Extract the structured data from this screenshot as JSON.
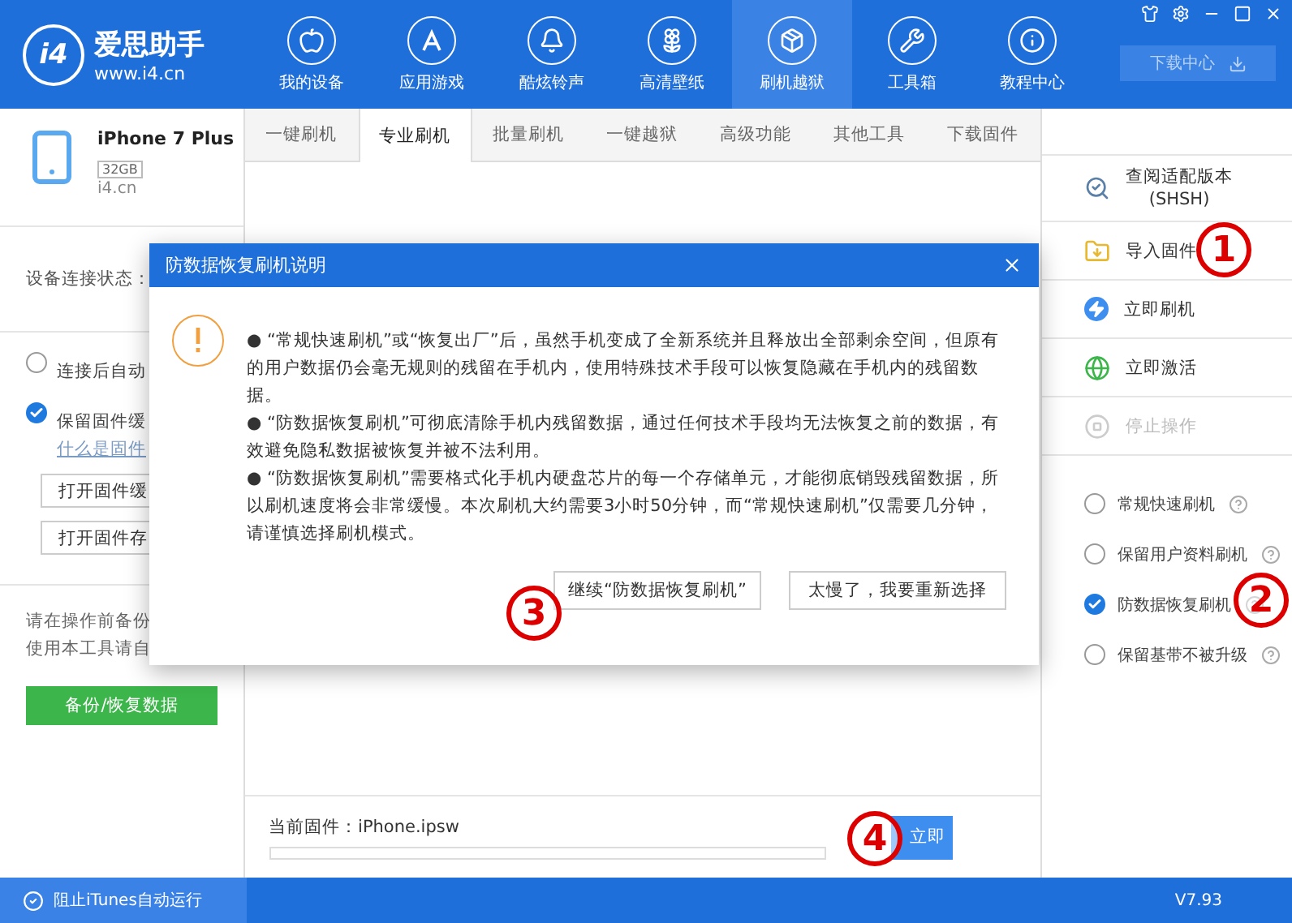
{
  "app": {
    "logo_mark": "i4",
    "name": "爱思助手",
    "url": "www.i4.cn"
  },
  "nav": [
    {
      "label": "我的设备",
      "selected": false
    },
    {
      "label": "应用游戏",
      "selected": false
    },
    {
      "label": "酷炫铃声",
      "selected": false
    },
    {
      "label": "高清壁纸",
      "selected": false
    },
    {
      "label": "刷机越狱",
      "selected": true
    },
    {
      "label": "工具箱",
      "selected": false
    },
    {
      "label": "教程中心",
      "selected": false
    }
  ],
  "download_center": "下载中心",
  "device": {
    "name": "iPhone 7 Plus",
    "capacity": "32GB",
    "source": "i4.cn"
  },
  "sidebar": {
    "status_label": "设备连接状态：",
    "options": [
      {
        "label": "连接后自动",
        "checked": false
      },
      {
        "label": "保留固件缓",
        "checked": true,
        "link": "什么是固件"
      }
    ],
    "buttons": [
      "打开固件缓",
      "打开固件存"
    ],
    "notice": [
      "请在操作前备份",
      "使用本工具请自"
    ],
    "backup_button": "备份/恢复数据"
  },
  "tabs": [
    {
      "label": "一键刷机",
      "selected": false
    },
    {
      "label": "专业刷机",
      "selected": true
    },
    {
      "label": "批量刷机",
      "selected": false
    },
    {
      "label": "一键越狱",
      "selected": false
    },
    {
      "label": "高级功能",
      "selected": false
    },
    {
      "label": "其他工具",
      "selected": false
    },
    {
      "label": "下载固件",
      "selected": false
    }
  ],
  "firmware": {
    "label": "当前固件：iPhone.ipsw",
    "level": 0,
    "button": "立即"
  },
  "actions": [
    {
      "label": "查阅适配版本",
      "sub": "(SHSH)",
      "disabled": false
    },
    {
      "label": "导入固件",
      "disabled": false
    },
    {
      "label": "立即刷机",
      "disabled": false
    },
    {
      "label": "立即激活",
      "disabled": false
    },
    {
      "label": "停止操作",
      "disabled": true
    }
  ],
  "modes": [
    {
      "label": "常规快速刷机",
      "selected": false
    },
    {
      "label": "保留用户资料刷机",
      "selected": false
    },
    {
      "label": "防数据恢复刷机",
      "selected": true
    },
    {
      "label": "保留基带不被升级",
      "selected": false
    }
  ],
  "dialog": {
    "title": "防数据恢复刷机说明",
    "paragraphs": [
      "● “常规快速刷机”或“恢复出厂”后，虽然手机变成了全新系统并且释放出全部剩余空间，但原有的用户数据仍会毫无规则的残留在手机内，使用特殊技术手段可以恢复隐藏在手机内的残留数据。",
      "● “防数据恢复刷机”可彻底清除手机内残留数据，通过任何技术手段均无法恢复之前的数据，有效避免隐私数据被恢复并被不法利用。",
      "● “防数据恢复刷机”需要格式化手机内硬盘芯片的每一个存储单元，才能彻底销毁残留数据，所以刷机速度将会非常缓慢。本次刷机大约需要3小时50分钟，而“常规快速刷机”仅需要几分钟，请谨慎选择刷机模式。"
    ],
    "buttons": [
      "继续“防数据恢复刷机”",
      "太慢了，我要重新选择"
    ]
  },
  "annotations": [
    "1",
    "2",
    "3",
    "4"
  ],
  "status_bar": {
    "itunes_block": "阻止iTunes自动运行",
    "version": "V7.93"
  }
}
